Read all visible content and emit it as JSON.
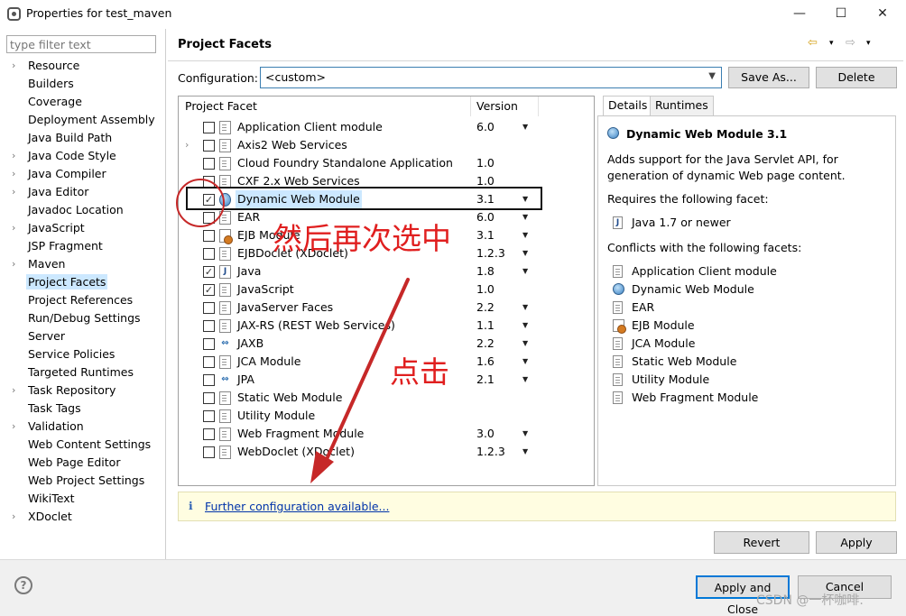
{
  "window": {
    "title": "Properties for test_maven",
    "minimize": "—",
    "maximize": "☐",
    "close": "✕"
  },
  "filter": {
    "placeholder": "type filter text",
    "value": ""
  },
  "tree": {
    "items": [
      {
        "label": "Resource",
        "expandable": true
      },
      {
        "label": "Builders",
        "expandable": false
      },
      {
        "label": "Coverage",
        "expandable": false
      },
      {
        "label": "Deployment Assembly",
        "expandable": false
      },
      {
        "label": "Java Build Path",
        "expandable": false
      },
      {
        "label": "Java Code Style",
        "expandable": true
      },
      {
        "label": "Java Compiler",
        "expandable": true
      },
      {
        "label": "Java Editor",
        "expandable": true
      },
      {
        "label": "Javadoc Location",
        "expandable": false
      },
      {
        "label": "JavaScript",
        "expandable": true
      },
      {
        "label": "JSP Fragment",
        "expandable": false
      },
      {
        "label": "Maven",
        "expandable": true
      },
      {
        "label": "Project Facets",
        "expandable": false,
        "selected": true
      },
      {
        "label": "Project References",
        "expandable": false
      },
      {
        "label": "Run/Debug Settings",
        "expandable": false
      },
      {
        "label": "Server",
        "expandable": false
      },
      {
        "label": "Service Policies",
        "expandable": false
      },
      {
        "label": "Targeted Runtimes",
        "expandable": false
      },
      {
        "label": "Task Repository",
        "expandable": true
      },
      {
        "label": "Task Tags",
        "expandable": false
      },
      {
        "label": "Validation",
        "expandable": true
      },
      {
        "label": "Web Content Settings",
        "expandable": false
      },
      {
        "label": "Web Page Editor",
        "expandable": false
      },
      {
        "label": "Web Project Settings",
        "expandable": false
      },
      {
        "label": "WikiText",
        "expandable": false
      },
      {
        "label": "XDoclet",
        "expandable": true
      }
    ]
  },
  "page": {
    "title": "Project Facets",
    "nav_back": "⇦",
    "nav_forward": "⇨",
    "nav_menu": "▾"
  },
  "config": {
    "label": "Configuration:",
    "value": "<custom>",
    "save_as": "Save As...",
    "delete": "Delete"
  },
  "facets": {
    "header_facet": "Project Facet",
    "header_version": "Version",
    "rows": [
      {
        "name": "Application Client module",
        "version": "6.0",
        "checked": false,
        "icon": "doc",
        "dropdown": true,
        "expandable": false
      },
      {
        "name": "Axis2 Web Services",
        "version": "",
        "checked": false,
        "icon": "doc",
        "dropdown": false,
        "expandable": true
      },
      {
        "name": "Cloud Foundry Standalone Application",
        "version": "1.0",
        "checked": false,
        "icon": "doc",
        "dropdown": false,
        "expandable": false
      },
      {
        "name": "CXF 2.x Web Services",
        "version": "1.0",
        "checked": false,
        "icon": "doc",
        "dropdown": false,
        "expandable": false
      },
      {
        "name": "Dynamic Web Module",
        "version": "3.1",
        "checked": true,
        "icon": "globe",
        "dropdown": true,
        "expandable": false,
        "selected": true
      },
      {
        "name": "EAR",
        "version": "6.0",
        "checked": false,
        "icon": "doc",
        "dropdown": true,
        "expandable": false
      },
      {
        "name": "EJB Module",
        "version": "3.1",
        "checked": false,
        "icon": "ejb",
        "dropdown": true,
        "expandable": false
      },
      {
        "name": "EJBDoclet (XDoclet)",
        "version": "1.2.3",
        "checked": false,
        "icon": "doc",
        "dropdown": true,
        "expandable": false
      },
      {
        "name": "Java",
        "version": "1.8",
        "checked": true,
        "icon": "java",
        "dropdown": true,
        "expandable": false
      },
      {
        "name": "JavaScript",
        "version": "1.0",
        "checked": true,
        "icon": "doc",
        "dropdown": false,
        "expandable": false
      },
      {
        "name": "JavaServer Faces",
        "version": "2.2",
        "checked": false,
        "icon": "doc",
        "dropdown": true,
        "expandable": false
      },
      {
        "name": "JAX-RS (REST Web Services)",
        "version": "1.1",
        "checked": false,
        "icon": "doc",
        "dropdown": true,
        "expandable": false
      },
      {
        "name": "JAXB",
        "version": "2.2",
        "checked": false,
        "icon": "jaxb",
        "dropdown": true,
        "expandable": false
      },
      {
        "name": "JCA Module",
        "version": "1.6",
        "checked": false,
        "icon": "doc",
        "dropdown": true,
        "expandable": false
      },
      {
        "name": "JPA",
        "version": "2.1",
        "checked": false,
        "icon": "jaxb",
        "dropdown": true,
        "expandable": false
      },
      {
        "name": "Static Web Module",
        "version": "",
        "checked": false,
        "icon": "doc",
        "dropdown": false,
        "expandable": false
      },
      {
        "name": "Utility Module",
        "version": "",
        "checked": false,
        "icon": "doc",
        "dropdown": false,
        "expandable": false
      },
      {
        "name": "Web Fragment Module",
        "version": "3.0",
        "checked": false,
        "icon": "doc",
        "dropdown": true,
        "expandable": false
      },
      {
        "name": "WebDoclet (XDoclet)",
        "version": "1.2.3",
        "checked": false,
        "icon": "doc",
        "dropdown": true,
        "expandable": false
      }
    ]
  },
  "details": {
    "tab_details": "Details",
    "tab_runtimes": "Runtimes",
    "title": "Dynamic Web Module 3.1",
    "description": "Adds support for the Java Servlet API, for generation of dynamic Web page content.",
    "requires_heading": "Requires the following facet:",
    "requires": [
      {
        "label": "Java 1.7 or newer",
        "icon": "java"
      }
    ],
    "conflicts_heading": "Conflicts with the following facets:",
    "conflicts": [
      {
        "label": "Application Client module",
        "icon": "doc"
      },
      {
        "label": "Dynamic Web Module",
        "icon": "globe"
      },
      {
        "label": "EAR",
        "icon": "doc"
      },
      {
        "label": "EJB Module",
        "icon": "ejb"
      },
      {
        "label": "JCA Module",
        "icon": "doc"
      },
      {
        "label": "Static Web Module",
        "icon": "doc"
      },
      {
        "label": "Utility Module",
        "icon": "doc"
      },
      {
        "label": "Web Fragment Module",
        "icon": "doc"
      }
    ]
  },
  "info": {
    "icon": "ℹ",
    "link": "Further configuration available..."
  },
  "buttons": {
    "revert": "Revert",
    "apply": "Apply",
    "apply_and_close": "Apply and Close",
    "cancel": "Cancel",
    "help": "?"
  },
  "annotations": {
    "text_reselect": "然后再次选中",
    "text_click": "点击",
    "color": "#e01f1f"
  },
  "watermark": "CSDN @一杯咖啡."
}
